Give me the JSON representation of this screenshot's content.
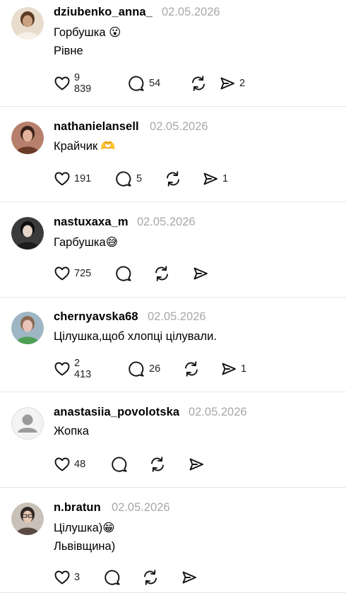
{
  "posts": [
    {
      "username": "dziubenko_anna_",
      "date": "02.05.2026",
      "lines": [
        "Горбушка 😮",
        "Рівне"
      ],
      "likes": "9 839",
      "comments": "54",
      "reposts": "",
      "shares": "2",
      "avatar_style": "photo-light"
    },
    {
      "username": "nathanielansell",
      "date": "02.05.2026",
      "lines": [
        "Крайчик 🫶"
      ],
      "likes": "191",
      "comments": "5",
      "reposts": "",
      "shares": "1",
      "avatar_style": "photo-warm"
    },
    {
      "username": "nastuxaxa_m",
      "date": "02.05.2026",
      "lines": [
        "Гарбушка😅"
      ],
      "likes": "725",
      "comments": "",
      "reposts": "",
      "shares": "",
      "avatar_style": "photo-dark"
    },
    {
      "username": "chernyavska68",
      "date": "02.05.2026",
      "lines": [
        "Цілушка,щоб хлопці цілували."
      ],
      "likes": "2 413",
      "comments": "26",
      "reposts": "",
      "shares": "1",
      "avatar_style": "photo-green"
    },
    {
      "username": "anastasiia_povolotska",
      "date": "02.05.2026",
      "lines": [
        "Жопка"
      ],
      "likes": "48",
      "comments": "",
      "reposts": "",
      "shares": "",
      "avatar_style": "default"
    },
    {
      "username": "n.bratun",
      "date": "02.05.2026",
      "lines": [
        "Цілушка)😁",
        "Львівщина)"
      ],
      "likes": "3",
      "comments": "",
      "reposts": "",
      "shares": "",
      "avatar_style": "photo-glasses"
    }
  ],
  "icons": {
    "like": "heart-icon",
    "comment": "comment-bubble-icon",
    "repost": "repost-icon",
    "share": "send-icon"
  }
}
